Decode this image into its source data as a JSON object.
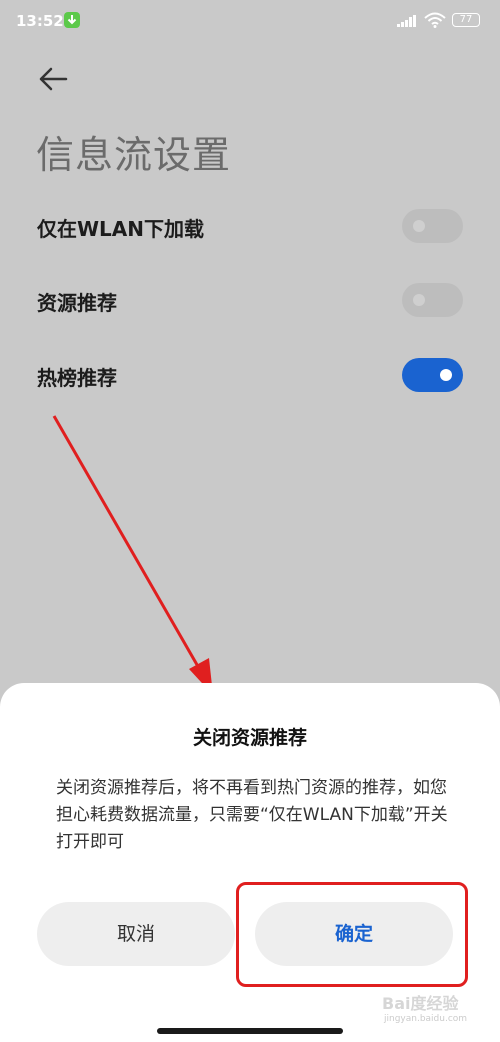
{
  "status_bar": {
    "time": "13:52",
    "battery": "77"
  },
  "page": {
    "title": "信息流设置"
  },
  "settings": [
    {
      "label": "仅在WLAN下加载",
      "enabled": false
    },
    {
      "label": "资源推荐",
      "enabled": false
    },
    {
      "label": "热榜推荐",
      "enabled": true
    }
  ],
  "dialog": {
    "title": "关闭资源推荐",
    "message": "关闭资源推荐后，将不再看到热门资源的推荐，如您担心耗费数据流量，只需要“仅在WLAN下加载”开关打开即可",
    "cancel_label": "取消",
    "confirm_label": "确定"
  },
  "watermark": {
    "brand": "Bai度经验",
    "url": "jingyan.baidu.com"
  },
  "colors": {
    "accent": "#1a63d0",
    "annotation": "#e01f1f",
    "overlay": "#c9c9c9"
  }
}
